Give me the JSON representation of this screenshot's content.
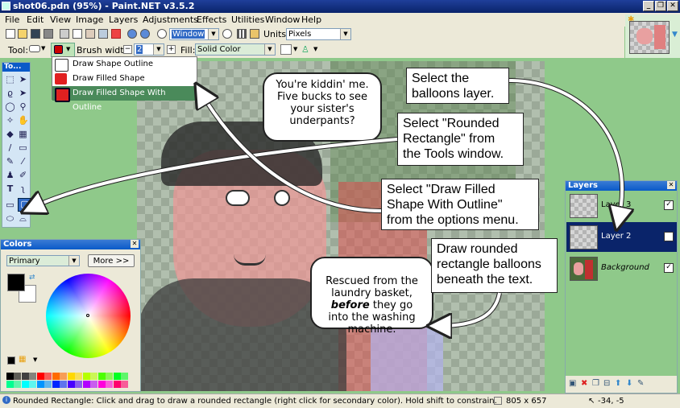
{
  "window": {
    "title": "shot06.pdn (95%) - Paint.NET v3.5.2",
    "minimize": "_",
    "restore": "❐",
    "close": "✕"
  },
  "menu": [
    "File",
    "Edit",
    "View",
    "Image",
    "Layers",
    "Adjustments",
    "Effects",
    "Utilities",
    "Window",
    "Help"
  ],
  "toolbar": {
    "zoom_value": "Window",
    "units_label": "Units:",
    "units_value": "Pixels",
    "tool_label": "Tool:",
    "brush_width_label": "Brush width:",
    "brush_width_value": "2",
    "fill_label": "Fill:",
    "fill_value": "Solid Color"
  },
  "shape_menu": {
    "items": [
      "Draw Shape Outline",
      "Draw Filled Shape",
      "Draw Filled Shape With Outline"
    ],
    "selected_index": 2
  },
  "tools_panel": {
    "title": "To..."
  },
  "colors_panel": {
    "title": "Colors",
    "mode": "Primary",
    "more_button": "More >>",
    "primary": "#000000",
    "secondary": "#ffffff",
    "palette": [
      "#000000",
      "#404040",
      "#ff0000",
      "#ff6a00",
      "#ffd800",
      "#b6ff00",
      "#4cff00",
      "#00ff21",
      "#00ff90",
      "#00ffff",
      "#0094ff",
      "#0026ff",
      "#4800ff",
      "#b200ff",
      "#ff00dc",
      "#ff006e"
    ]
  },
  "layers_panel": {
    "title": "Layers",
    "layers": [
      {
        "name": "Layer 3",
        "visible": true,
        "selected": false
      },
      {
        "name": "Layer 2",
        "visible": true,
        "selected": true
      },
      {
        "name": "Background",
        "visible": true,
        "selected": false
      }
    ]
  },
  "callouts": {
    "balloons_layer": "Select the\nballoons layer.",
    "rounded_rect": "Select \"Rounded\nRectangle\" from\nthe Tools window.",
    "filled_shape": "Select \"Draw Filled\nShape With Outline\"\nfrom the options menu.",
    "draw_balloons": "Draw rounded\nrectangle balloons\nbeneath the text."
  },
  "comic": {
    "bubble_top": "You're kiddin' me.\nFive bucks to see\nyour sister's\nunderpants?",
    "bubble_bottom_1": "Rescued from the\nlaundry basket,",
    "bubble_bottom_bold": "before",
    "bubble_bottom_2": " they go\ninto the washing\nmachine."
  },
  "status": {
    "message": "Rounded Rectangle: Click and drag to draw a rounded rectangle (right click for secondary color). Hold shift to constrain.",
    "image_size": "805 x 657",
    "cursor_pos": "-34, -5"
  },
  "colors": {
    "accent": "#0a246a",
    "selection": "#4a8a5a",
    "window_bg": "#8fc98a",
    "arrow": "#ffffff"
  }
}
